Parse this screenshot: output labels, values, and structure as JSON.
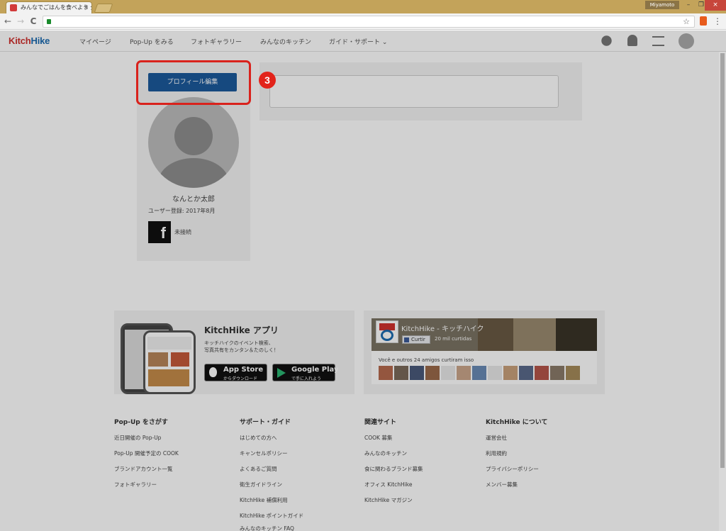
{
  "browser": {
    "tab_title": "みんなでごはんを食べよう 全",
    "tab_close": "×",
    "user_label": "Miyamoto",
    "window_minimize": "–",
    "window_maximize": "❐",
    "window_close": "×",
    "nav_back": "←",
    "nav_forward": "→",
    "nav_reload": "C",
    "star": "☆",
    "menu": "⋮"
  },
  "site": {
    "logo_kitch": "Kitch",
    "logo_hike": "Hike",
    "nav": [
      "マイページ",
      "Pop-Up をみる",
      "フォトギャラリー",
      "みんなのキッチン",
      "ガイド・サポート ⌄"
    ]
  },
  "profile": {
    "edit_button": "プロフィール編集",
    "name": "なんとか太郎",
    "registered": "ユーザー登録: 2017年8月",
    "facebook_letter": "f",
    "facebook_status": "未接続"
  },
  "annotation": {
    "step": "3"
  },
  "app_promo": {
    "title": "KitchHike アプリ",
    "desc1": "キッチハイクのイベント検索、",
    "desc2": "写真共有をカンタン＆たのしく！",
    "appstore_big": "App Store",
    "appstore_small": "からダウンロード",
    "googleplay_big": "Google Play",
    "googleplay_small": "で手に入れよう"
  },
  "fb_widget": {
    "page_name": "KitchHike - キッチハイク",
    "like_label": "Curtir",
    "like_count": "20 mil curtidas",
    "friends_text": "Você e outros 24 amigos curtiram isso"
  },
  "footer": {
    "columns": [
      {
        "title": "Pop-Up をさがす",
        "links": [
          "近日開催の Pop-Up",
          "Pop-Up 開催予定の COOK",
          "ブランドアカウント一覧",
          "フォトギャラリー"
        ]
      },
      {
        "title": "サポート・ガイド",
        "links": [
          "はじめての方へ",
          "キャンセルポリシー",
          "よくあるご質問",
          "衛生ガイドライン",
          "KitchHike 補償利用",
          "KitchHike ポイントガイド",
          "みんなのキッチン FAQ"
        ]
      },
      {
        "title": "関連サイト",
        "links": [
          "COOK 募集",
          "みんなのキッチン",
          "食に関わるブランド募集",
          "オフィス KitchHike",
          "KitchHike マガジン"
        ]
      },
      {
        "title": "KitchHike について",
        "links": [
          "運営会社",
          "利用規約",
          "プライバシーポリシー",
          "メンバー募集"
        ]
      }
    ]
  },
  "colors": {
    "brand_red": "#d0302e",
    "brand_blue": "#1c6bb0",
    "edit_button": "#1c5a9c",
    "highlight": "#d9221c"
  },
  "icons": [
    "chat-icon",
    "bell-icon",
    "checklist-icon",
    "user-avatar-icon",
    "lock-icon",
    "star-icon",
    "office-icon",
    "facebook-icon",
    "apple-icon",
    "google-play-icon"
  ]
}
